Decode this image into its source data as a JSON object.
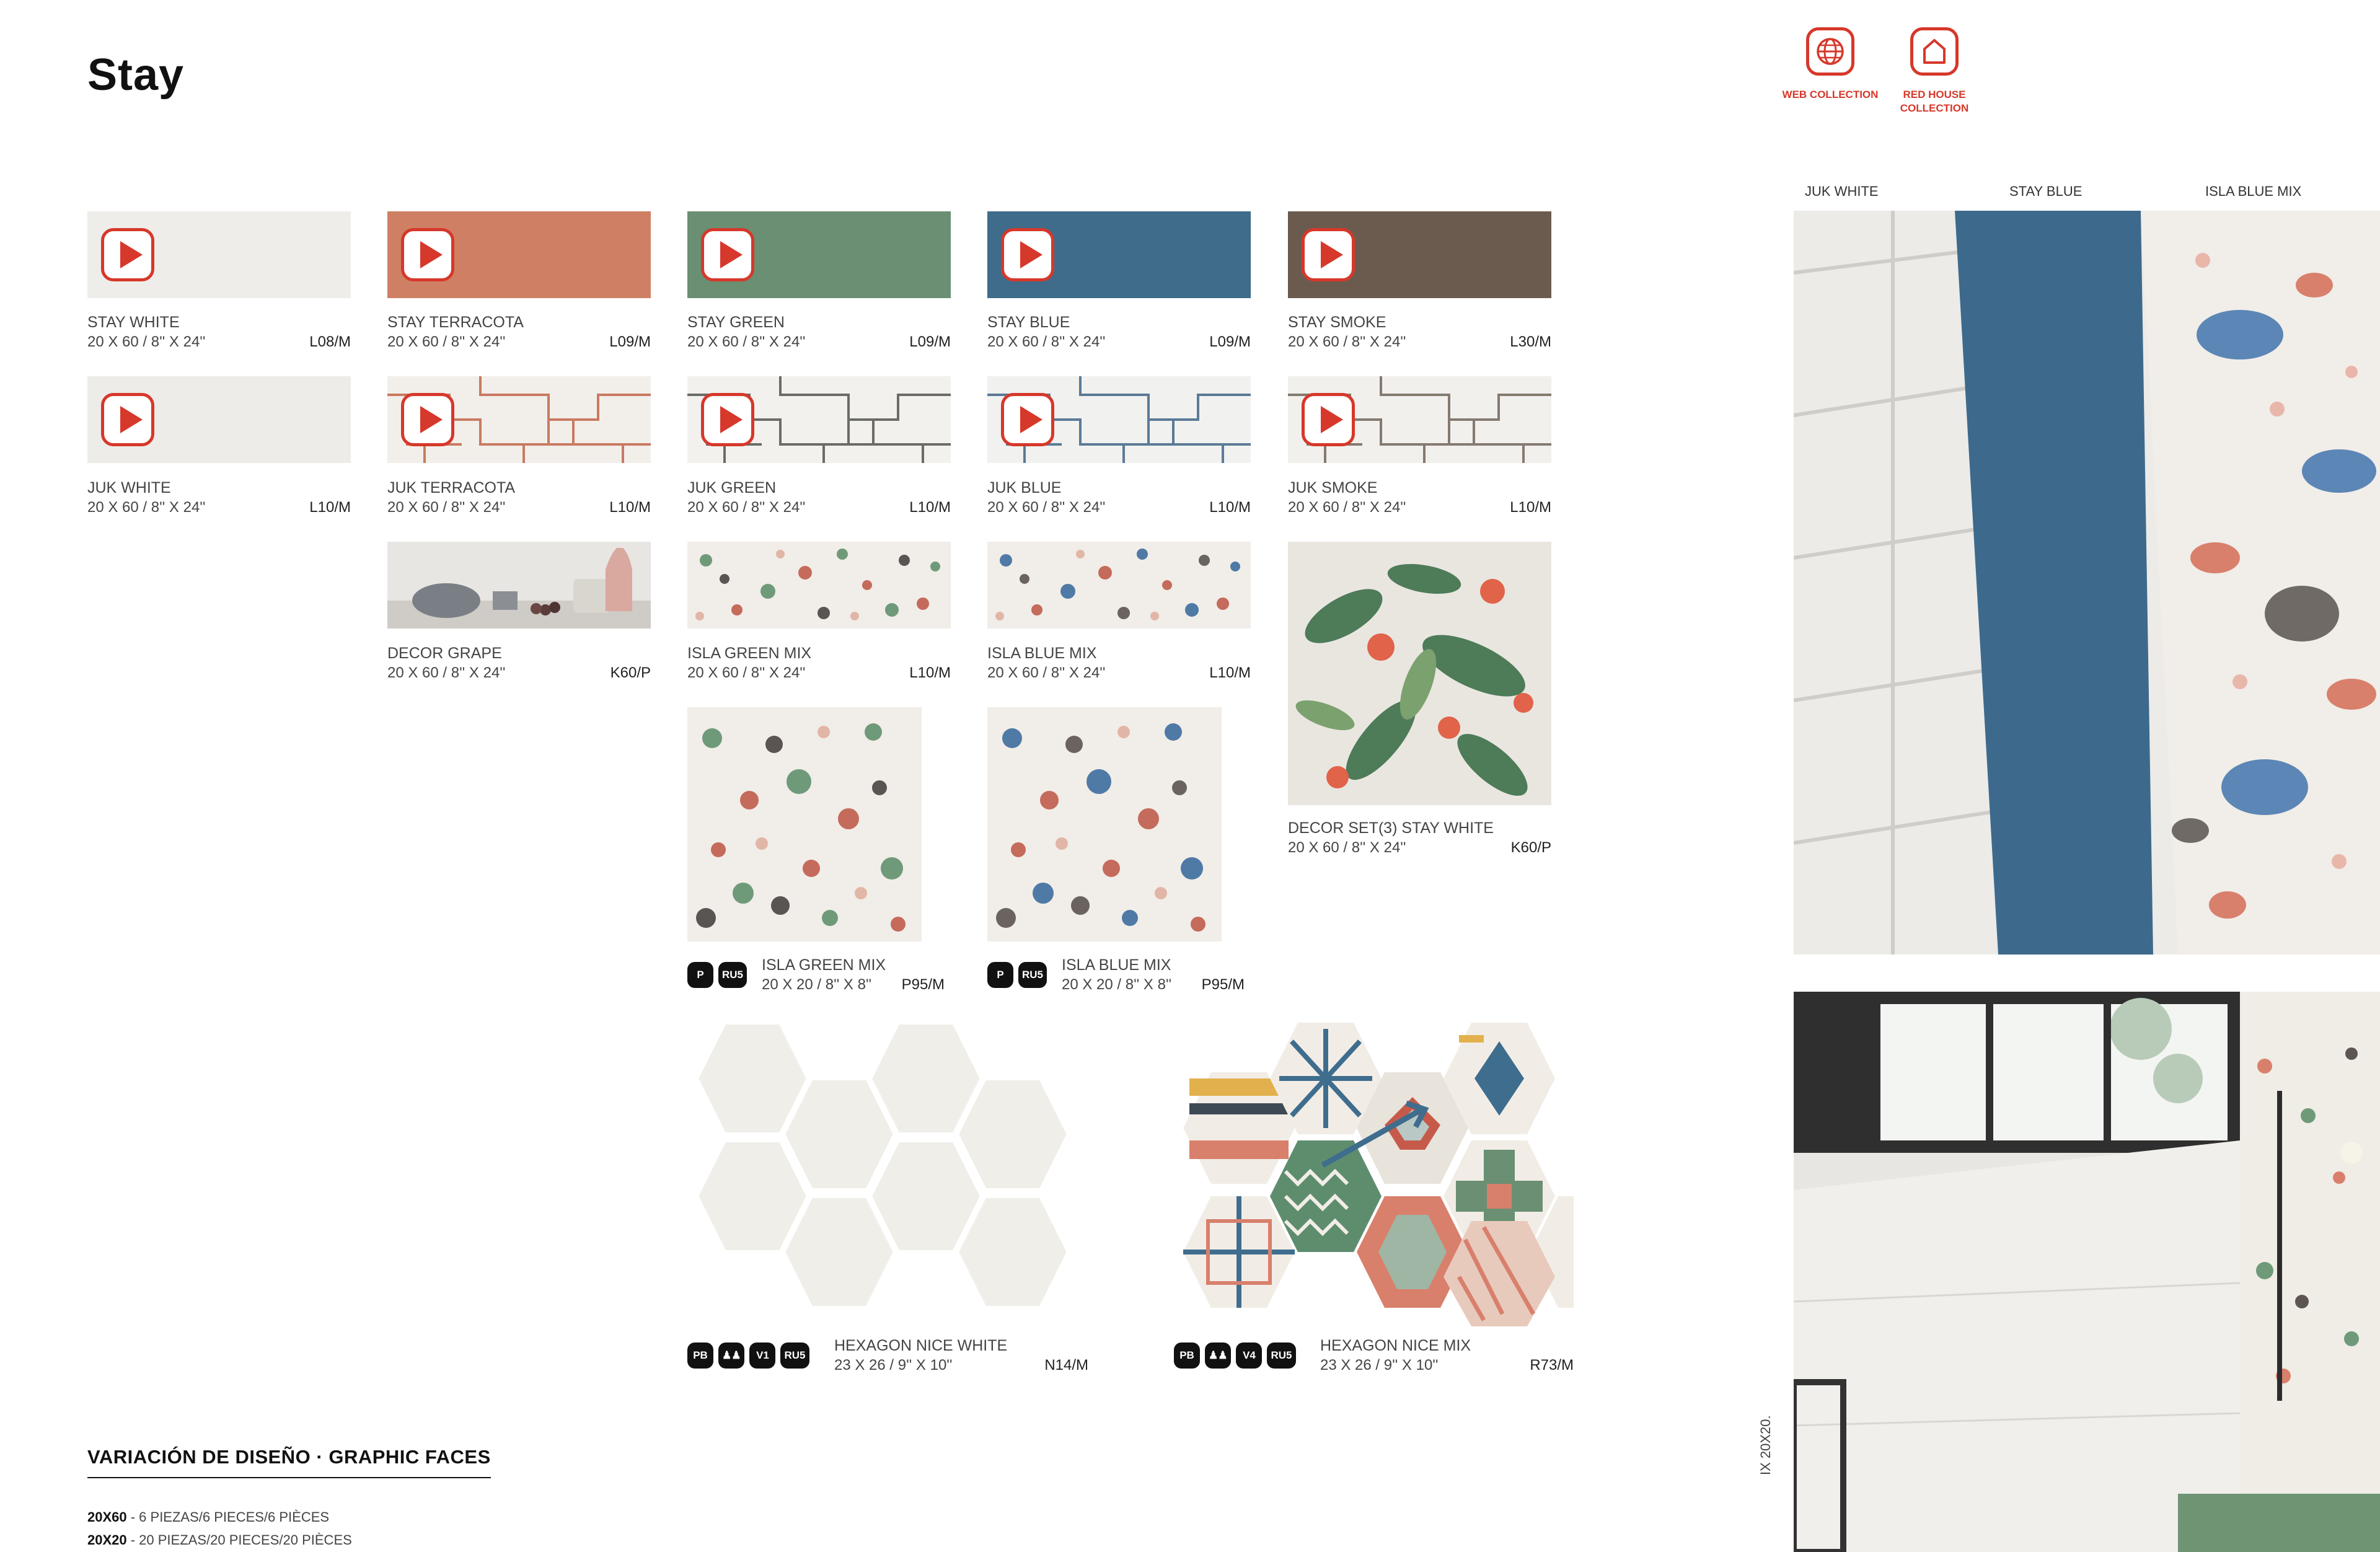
{
  "page": {
    "title": "Stay"
  },
  "collections": [
    {
      "icon": "globe-icon",
      "label": "WEB COLLECTION"
    },
    {
      "icon": "house-icon",
      "label": "RED HOUSE COLLECTION"
    }
  ],
  "colors": {
    "accent": "#d6382b",
    "terracota": "#cf8064",
    "green": "#6a8f72",
    "blue": "#3e6c8a",
    "smoke": "#6b5b4f",
    "white_tile": "#efedea"
  },
  "products": [
    {
      "name": "STAY WHITE",
      "size": "20 X 60 / 8'' X 24''",
      "code": "L08/M"
    },
    {
      "name": "STAY TERRACOTA",
      "size": "20 X 60 / 8'' X 24''",
      "code": "L09/M"
    },
    {
      "name": "STAY GREEN",
      "size": "20 X 60 / 8'' X 24''",
      "code": "L09/M"
    },
    {
      "name": "STAY BLUE",
      "size": "20 X 60 / 8'' X 24''",
      "code": "L09/M"
    },
    {
      "name": "STAY SMOKE",
      "size": "20 X 60 / 8'' X 24''",
      "code": "L30/M"
    },
    {
      "name": "JUK WHITE",
      "size": "20 X 60 / 8'' X 24''",
      "code": "L10/M"
    },
    {
      "name": "JUK TERRACOTA",
      "size": "20 X 60 / 8'' X 24''",
      "code": "L10/M"
    },
    {
      "name": "JUK GREEN",
      "size": "20 X 60 / 8'' X 24''",
      "code": "L10/M"
    },
    {
      "name": "JUK BLUE",
      "size": "20 X 60 / 8'' X 24''",
      "code": "L10/M"
    },
    {
      "name": "JUK SMOKE",
      "size": "20 X 60 / 8'' X 24''",
      "code": "L10/M"
    },
    {
      "name": "DECOR GRAPE",
      "size": "20 X 60 / 8'' X 24''",
      "code": "K60/P"
    },
    {
      "name": "ISLA GREEN MIX",
      "size": "20 X 60 / 8'' X 24''",
      "code": "L10/M"
    },
    {
      "name": "ISLA BLUE MIX",
      "size": "20 X 60 / 8'' X 24''",
      "code": "L10/M"
    },
    {
      "name": "DECOR SET(3) STAY WHITE",
      "size": "20 X 60 / 8'' X 24''",
      "code": "K60/P"
    },
    {
      "name": "ISLA GREEN MIX",
      "size": "20 X 20 / 8'' X 8''",
      "code": "P95/M",
      "badges": [
        "P",
        "RU5"
      ]
    },
    {
      "name": "ISLA BLUE MIX",
      "size": "20 X 20 / 8'' X 8''",
      "code": "P95/M",
      "badges": [
        "P",
        "RU5"
      ]
    },
    {
      "name": "HEXAGON NICE WHITE",
      "size": "23 X 26 / 9'' X 10''",
      "code": "N14/M",
      "badges": [
        "PB",
        "footprint",
        "V1",
        "RU5"
      ]
    },
    {
      "name": "HEXAGON NICE MIX",
      "size": "23 X 26 / 9'' X 10''",
      "code": "R73/M",
      "badges": [
        "PB",
        "footprint",
        "V4",
        "RU5"
      ]
    }
  ],
  "photo_labels": [
    "JUK WHITE",
    "STAY BLUE",
    "ISLA BLUE MIX"
  ],
  "footer": {
    "heading": "VARIACIÓN DE DISEÑO · GRAPHIC FACES",
    "line1_size": "20X60",
    "line1_text": " - 6 PIEZAS/6 PIECES/6 PIÈCES",
    "line2_size": "20X20",
    "line2_text": " - 20 PIEZAS/20 PIECES/20 PIÈCES"
  },
  "vertical_caption": "IX 20X20."
}
